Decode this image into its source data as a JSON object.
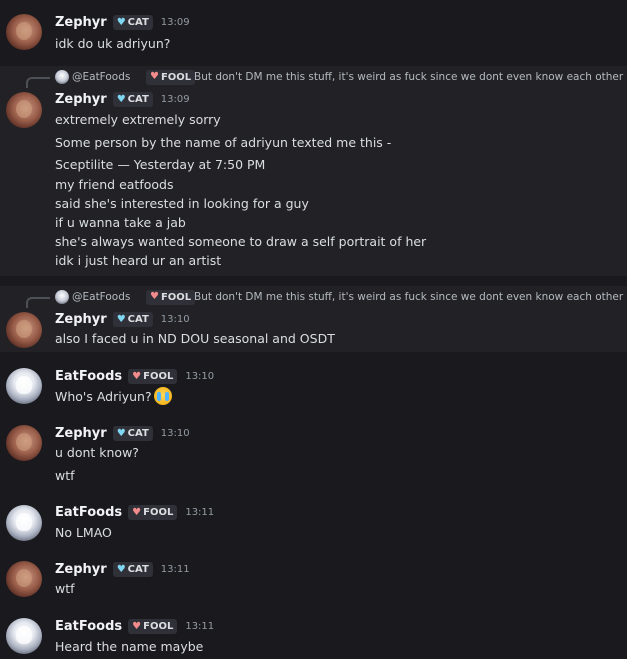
{
  "users": {
    "zephyr": {
      "name": "Zephyr",
      "tag": "CAT",
      "tag_icon": "heart-icon",
      "tag_color": "#7fd7f2"
    },
    "eatfoods": {
      "name": "EatFoods",
      "tag": "FOOL",
      "tag_icon": "heart-icon",
      "tag_color": "#f28b8b"
    }
  },
  "reply_ref": {
    "name": "@EatFoods",
    "tag": "FOOL",
    "text": "But don't DM me this stuff, it's weird as fuck since we dont even know each other"
  },
  "messages": [
    {
      "user": "Zephyr",
      "tag": "CAT",
      "time": "13:09",
      "lines": [
        "idk do uk adriyun?"
      ]
    },
    {
      "user": "Zephyr",
      "tag": "CAT",
      "time": "13:09",
      "lines": [
        "extremely extremely sorry",
        "Some person by the name of adriyun texted me this -",
        "Sceptilite — Yesterday at 7:50 PM",
        "my friend eatfoods",
        "said she's interested in looking for a guy",
        "if u wanna take a jab",
        "she's always wanted someone to draw a self portrait of her",
        "idk i just heard ur an artist"
      ]
    },
    {
      "user": "Zephyr",
      "tag": "CAT",
      "time": "13:10",
      "lines": [
        "also I faced u in ND DOU seasonal and OSDT"
      ]
    },
    {
      "user": "EatFoods",
      "tag": "FOOL",
      "time": "13:10",
      "lines": [
        "Who's Adriyun?"
      ],
      "emoji": "loudly-crying-face"
    },
    {
      "user": "Zephyr",
      "tag": "CAT",
      "time": "13:10",
      "lines": [
        "u dont know?",
        "wtf"
      ]
    },
    {
      "user": "EatFoods",
      "tag": "FOOL",
      "time": "13:11",
      "lines": [
        "No LMAO"
      ]
    },
    {
      "user": "Zephyr",
      "tag": "CAT",
      "time": "13:11",
      "lines": [
        "wtf"
      ]
    },
    {
      "user": "EatFoods",
      "tag": "FOOL",
      "time": "13:11",
      "lines": [
        "Heard the name maybe"
      ]
    }
  ]
}
